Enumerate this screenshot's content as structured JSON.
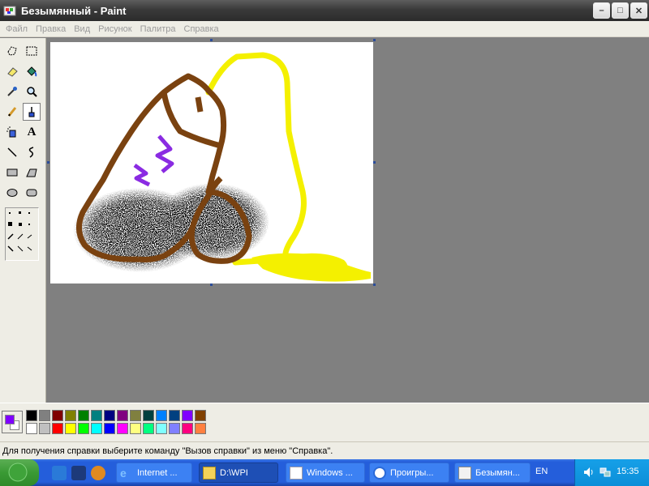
{
  "window": {
    "title": "Безымянный - Paint",
    "controls": [
      "minimize-icon",
      "maximize-icon",
      "close-icon"
    ]
  },
  "menu": [
    "Файл",
    "Правка",
    "Вид",
    "Рисунок",
    "Палитра",
    "Справка"
  ],
  "tools": [
    "free-select",
    "rect-select",
    "eraser",
    "fill",
    "color-picker",
    "magnifier",
    "pencil",
    "brush",
    "airbrush",
    "text",
    "line",
    "curve",
    "rectangle",
    "polygon",
    "ellipse",
    "rounded-rectangle"
  ],
  "active_tool": "brush",
  "palette": {
    "primary_color": "#7f00ff",
    "secondary_color": "#ffffff",
    "colors": [
      "#000000",
      "#808080",
      "#800000",
      "#808000",
      "#008000",
      "#008080",
      "#000080",
      "#800080",
      "#808040",
      "#004040",
      "#0080ff",
      "#004080",
      "#8000ff",
      "#804000",
      "#ffffff",
      "#c0c0c0",
      "#ff0000",
      "#ffff00",
      "#00ff00",
      "#00ffff",
      "#0000ff",
      "#ff00ff",
      "#ffff80",
      "#00ff80",
      "#80ffff",
      "#8080ff",
      "#ff0080",
      "#ff8040"
    ]
  },
  "statusbar": {
    "text": "Для получения справки выберите команду \"Вызов справки\" из меню \"Справка\"."
  },
  "taskbar": {
    "tasks": [
      {
        "label": "Internet ...",
        "icon": "ie-icon"
      },
      {
        "label": "D:\\WPI",
        "icon": "folder-icon"
      },
      {
        "label": "Windows ...",
        "icon": "window-icon"
      },
      {
        "label": "Проигры...",
        "icon": "media-player-icon"
      },
      {
        "label": "Безымян...",
        "icon": "paint-icon"
      }
    ],
    "language": "EN",
    "clock": "15:35"
  }
}
